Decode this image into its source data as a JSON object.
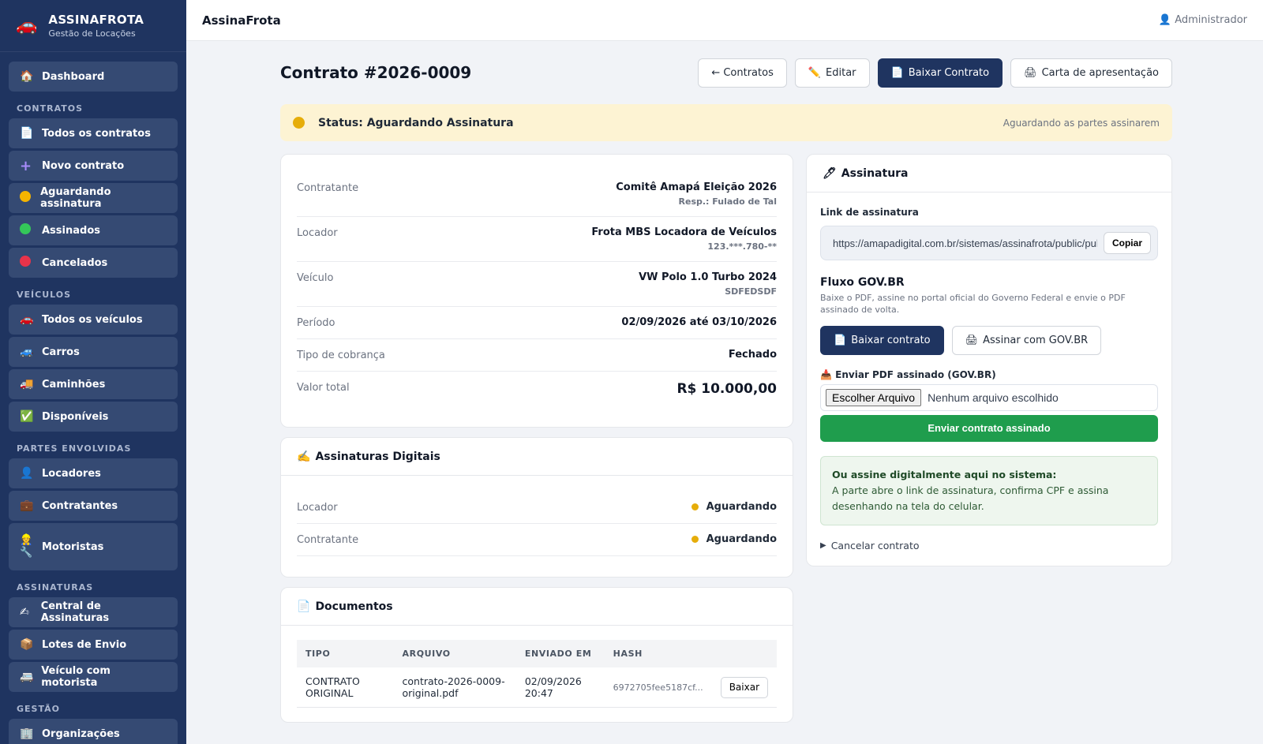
{
  "brand": {
    "title": "ASSINAFROTA",
    "subtitle": "Gestão de Locações",
    "icon": "🚗"
  },
  "sidebar": {
    "dashboard": {
      "icon": "🏠",
      "label": "Dashboard"
    },
    "sections": [
      {
        "title": "CONTRATOS",
        "items": [
          {
            "icon": "📄",
            "label": "Todos os contratos"
          },
          {
            "icon": "➕",
            "label": "Novo contrato"
          },
          {
            "icon": "🟡",
            "label": "Aguardando assinatura"
          },
          {
            "icon": "🟢",
            "label": "Assinados"
          },
          {
            "icon": "🔴",
            "label": "Cancelados"
          }
        ]
      },
      {
        "title": "VEÍCULOS",
        "items": [
          {
            "icon": "🚗",
            "label": "Todos os veículos"
          },
          {
            "icon": "🚙",
            "label": "Carros"
          },
          {
            "icon": "🚚",
            "label": "Caminhões"
          },
          {
            "icon": "✅",
            "label": "Disponíveis"
          }
        ]
      },
      {
        "title": "PARTES ENVOLVIDAS",
        "items": [
          {
            "icon": "👤",
            "label": "Locadores"
          },
          {
            "icon": "💼",
            "label": "Contratantes"
          },
          {
            "icon": "👷🔧",
            "label": "Motoristas"
          }
        ]
      },
      {
        "title": "ASSINATURAS",
        "items": [
          {
            "icon": "✍",
            "label": "Central de Assinaturas"
          },
          {
            "icon": "📦",
            "label": "Lotes de Envio"
          },
          {
            "icon": "🚐",
            "label": "Veículo com motorista"
          }
        ]
      },
      {
        "title": "GESTÃO",
        "items": [
          {
            "icon": "🏢",
            "label": "Organizações"
          }
        ]
      }
    ]
  },
  "topbar": {
    "title": "AssinaFrota",
    "user": "Administrador",
    "user_icon": "👤"
  },
  "page": {
    "title": "Contrato #2026-0009",
    "actions": {
      "back": "← Contratos",
      "edit": "Editar",
      "download": "Baixar Contrato",
      "letter": "Carta de apresentação"
    }
  },
  "status": {
    "label": "Status: Aguardando Assinatura",
    "note": "Aguardando as partes assinarem",
    "color": "#e6ad0a"
  },
  "details": {
    "contratante": {
      "label": "Contratante",
      "value": "Comitê Amapá Eleição 2026",
      "sub": "Resp.: Fulado de Tal"
    },
    "locador": {
      "label": "Locador",
      "value": "Frota MBS Locadora de Veículos",
      "sub": "123.***.780-**"
    },
    "veiculo": {
      "label": "Veículo",
      "value": "VW Polo 1.0 Turbo 2024",
      "sub": "SDFEDSDF"
    },
    "periodo": {
      "label": "Período",
      "value": "02/09/2026 até 03/10/2026"
    },
    "cobranca": {
      "label": "Tipo de cobrança",
      "value": "Fechado"
    },
    "total": {
      "label": "Valor total",
      "value": "R$ 10.000,00"
    }
  },
  "signatures": {
    "title": "Assinaturas Digitais",
    "rows": [
      {
        "party": "Locador",
        "status": "Aguardando"
      },
      {
        "party": "Contratante",
        "status": "Aguardando"
      }
    ]
  },
  "documents": {
    "title": "Documentos",
    "columns": [
      "TIPO",
      "ARQUIVO",
      "ENVIADO EM",
      "HASH"
    ],
    "rows": [
      {
        "tipo": "CONTRATO ORIGINAL",
        "arquivo": "contrato-2026-0009-original.pdf",
        "enviado": "02/09/2026 20:47",
        "hash": "6972705fee5187cf...",
        "action": "Baixar"
      }
    ]
  },
  "assinatura": {
    "title": "Assinatura",
    "link_label": "Link de assinatura",
    "link_value": "https://amapadigital.com.br/sistemas/assinafrota/public/publico/assinar",
    "copy": "Copiar",
    "gov_title": "Fluxo GOV.BR",
    "gov_desc": "Baixe o PDF, assine no portal oficial do Governo Federal e envie o PDF assinado de volta.",
    "gov_download": "Baixar contrato",
    "gov_sign": "Assinar com GOV.BR",
    "upload_label": "Enviar PDF assinado (GOV.BR)",
    "file_button": "Escolher Arquivo",
    "file_none": "Nenhum arquivo escolhido",
    "send": "Enviar contrato assinado",
    "info_title": "Ou assine digitalmente aqui no sistema:",
    "info_text": "A parte abre o link de assinatura, confirma CPF e assina desenhando na tela do celular.",
    "cancel": "Cancelar contrato"
  }
}
